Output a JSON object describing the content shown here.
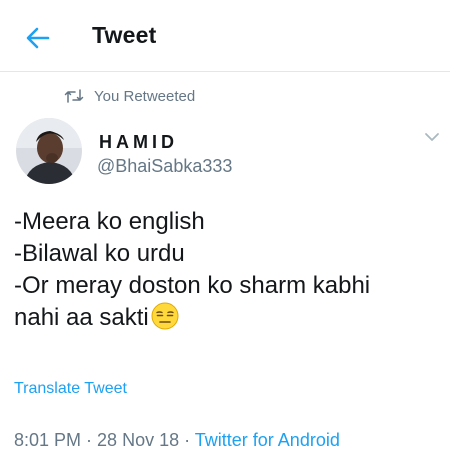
{
  "header": {
    "title": "Tweet",
    "back_icon": "arrow-left-icon",
    "accent": "#1da1f2"
  },
  "retweet": {
    "label": "You Retweeted",
    "icon": "retweet-icon"
  },
  "author": {
    "name": "HAMID",
    "handle": "@BhaiSabka333"
  },
  "tweet": {
    "lines": [
      "-Meera ko english",
      "-Bilawal ko urdu",
      "-Or meray doston ko sharm kabhi",
      "nahi aa sakti"
    ],
    "emoji": "expressionless-face-emoji"
  },
  "translate_label": "Translate Tweet",
  "meta": {
    "time": "8:01 PM",
    "separator": " · ",
    "date": "28 Nov 18",
    "source": "Twitter for Android"
  },
  "colors": {
    "text": "#14171a",
    "secondary": "#657786",
    "link": "#1da1f2",
    "divider": "#e1e8ed"
  }
}
